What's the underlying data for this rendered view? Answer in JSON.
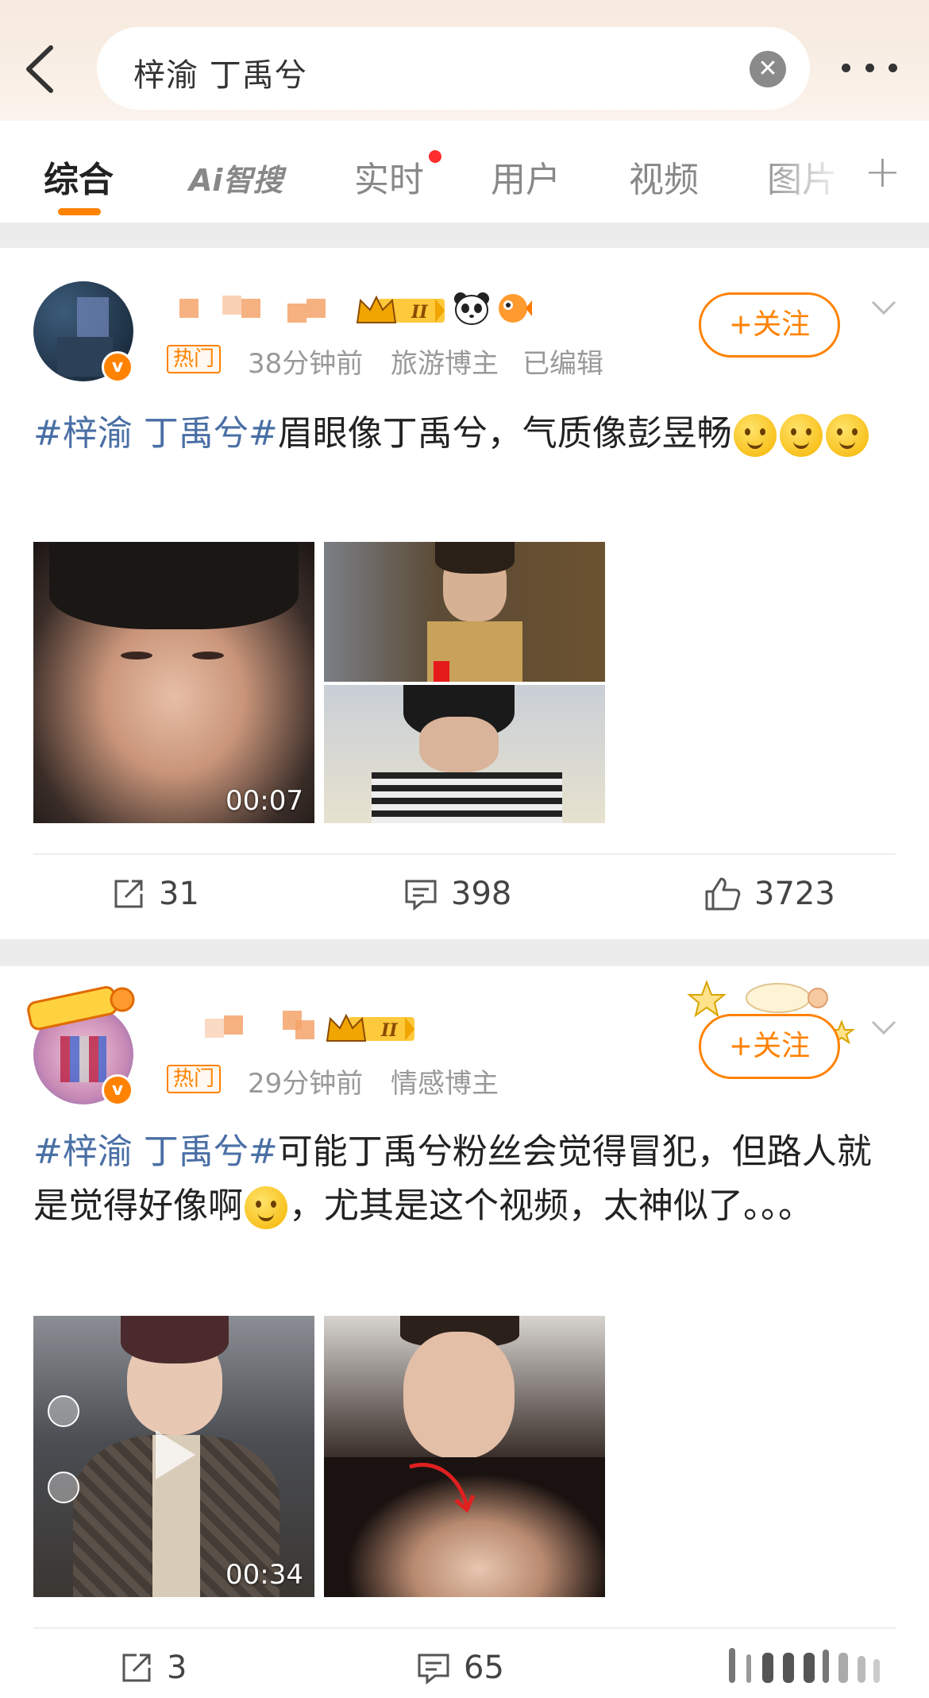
{
  "search": {
    "query": "梓渝 丁禹兮"
  },
  "tabs": [
    {
      "label": "综合"
    },
    {
      "label": "Ai智搜"
    },
    {
      "label": "实时"
    },
    {
      "label": "用户"
    },
    {
      "label": "视频"
    },
    {
      "label": "图片"
    }
  ],
  "posts": [
    {
      "hot_badge": "热门",
      "time": "38分钟前",
      "role": "旅游博主",
      "edited": "已编辑",
      "follow_label": "+关注",
      "hashtag": "#梓渝 丁禹兮#",
      "text": "眉眼像丁禹兮，气质像彭昱畅",
      "video_duration": "00:07",
      "reposts": "31",
      "comments": "398",
      "likes": "3723"
    },
    {
      "hot_badge": "热门",
      "time": "29分钟前",
      "role": "情感博主",
      "follow_label": "+关注",
      "hashtag": "#梓渝 丁禹兮#",
      "text_a": "可能丁禹兮粉丝会觉得冒犯，但路人就是觉得好像啊",
      "text_b": "，尤其是这个视频，太神似了。。。",
      "video_duration": "00:34",
      "reposts": "3",
      "comments": "65"
    }
  ],
  "colors": {
    "accent": "#ff8200",
    "hashtag": "#4a6fa5",
    "badge_dot": "#ff2d2d"
  }
}
